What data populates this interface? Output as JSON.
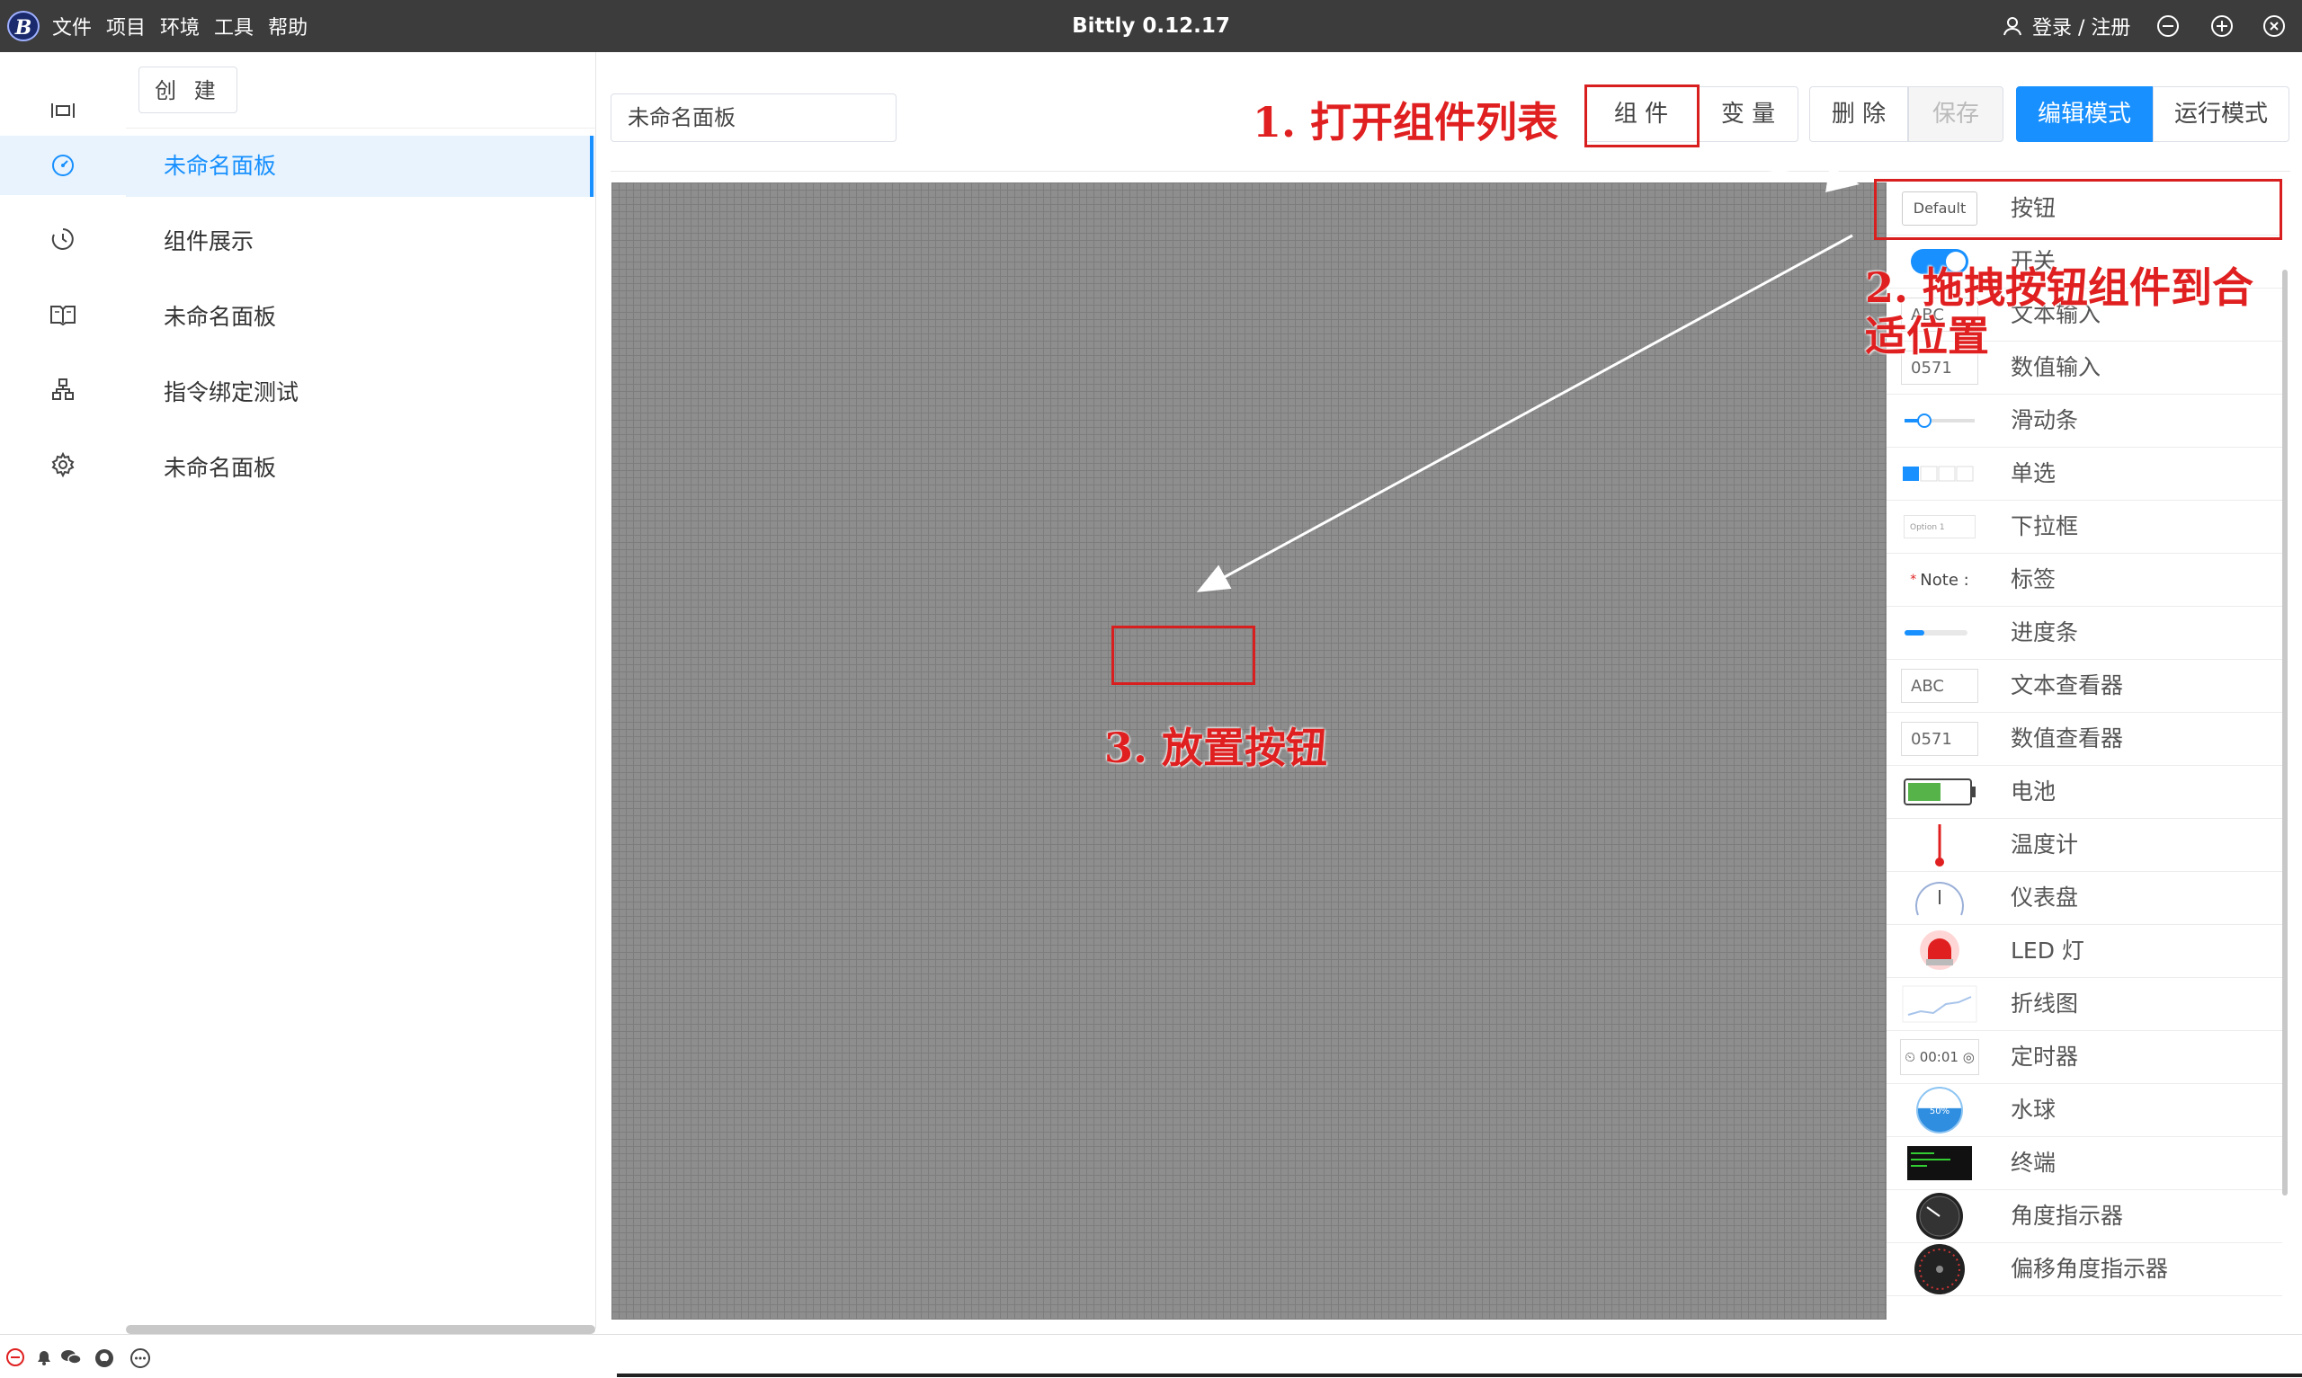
{
  "app": {
    "title": "Bittly 0.12.17",
    "logo_text": "B"
  },
  "menu": [
    "文件",
    "项目",
    "环境",
    "工具",
    "帮助"
  ],
  "user": {
    "label": "登录 / 注册"
  },
  "sidebar_icons": [
    "workspace-icon",
    "dashboard-icon",
    "history-icon",
    "docs-icon",
    "network-icon",
    "settings-icon"
  ],
  "panels": {
    "create_label": "创 建",
    "items": [
      "未命名面板",
      "组件展示",
      "未命名面板",
      "指令绑定测试",
      "未命名面板"
    ],
    "active_index": 0
  },
  "toolbar": {
    "panel_name": "未命名面板",
    "components": "组 件",
    "variables": "变 量",
    "delete": "删 除",
    "save": "保存",
    "edit_mode": "编辑模式",
    "run_mode": "运行模式"
  },
  "components": [
    {
      "label": "按钮",
      "icon": "button-preview",
      "preview_text": "Default"
    },
    {
      "label": "开关",
      "icon": "switch-preview"
    },
    {
      "label": "文本输入",
      "icon": "text-input-preview",
      "preview_text": "ABC"
    },
    {
      "label": "数值输入",
      "icon": "number-input-preview",
      "preview_text": "0571"
    },
    {
      "label": "滑动条",
      "icon": "slider-preview"
    },
    {
      "label": "单选",
      "icon": "radio-preview"
    },
    {
      "label": "下拉框",
      "icon": "select-preview",
      "preview_text": "Option 1"
    },
    {
      "label": "标签",
      "icon": "label-preview",
      "preview_text": "Note :"
    },
    {
      "label": "进度条",
      "icon": "progress-preview"
    },
    {
      "label": "文本查看器",
      "icon": "text-viewer-preview",
      "preview_text": "ABC"
    },
    {
      "label": "数值查看器",
      "icon": "number-viewer-preview",
      "preview_text": "0571"
    },
    {
      "label": "电池",
      "icon": "battery-preview"
    },
    {
      "label": "温度计",
      "icon": "thermometer-preview"
    },
    {
      "label": "仪表盘",
      "icon": "gauge-preview"
    },
    {
      "label": "LED 灯",
      "icon": "led-preview"
    },
    {
      "label": "折线图",
      "icon": "line-chart-preview"
    },
    {
      "label": "定时器",
      "icon": "timer-preview",
      "preview_text": "00:01"
    },
    {
      "label": "水球",
      "icon": "water-ball-preview",
      "preview_text": "50%"
    },
    {
      "label": "终端",
      "icon": "terminal-preview"
    },
    {
      "label": "角度指示器",
      "icon": "angle-indicator-preview"
    },
    {
      "label": "偏移角度指示器",
      "icon": "offset-angle-indicator-preview"
    }
  ],
  "annotations": {
    "step1": "1. 打开组件列表",
    "step2_line1": "2. 拖拽按钮组件到合",
    "step2_line2": "适位置",
    "step3": "3. 放置按钮"
  },
  "colors": {
    "accent": "#1890ff",
    "annotation": "#d81e1e",
    "titlebar": "#3c3c3c"
  },
  "status_icons": [
    "error-icon",
    "bell-icon",
    "wechat-icon",
    "github-icon",
    "chat-icon"
  ]
}
